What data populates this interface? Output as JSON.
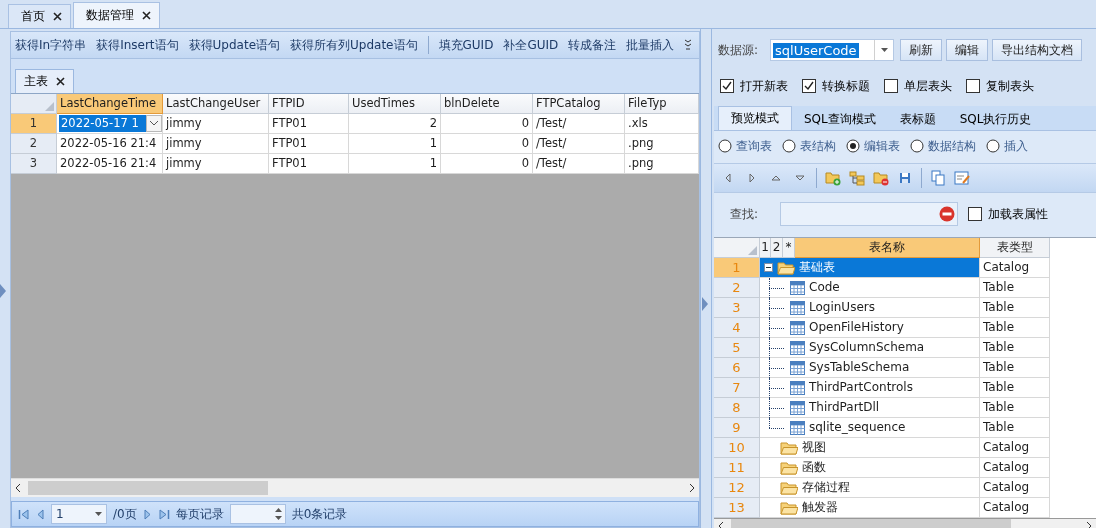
{
  "doc_tabs": [
    {
      "label": "首页",
      "selected": false
    },
    {
      "label": "数据管理",
      "selected": true
    }
  ],
  "toolbar": {
    "groups": [
      [
        "获得In字符串",
        "获得Insert语句",
        "获得Update语句",
        "获得所有列Update语句"
      ],
      [
        "填充GUID",
        "补全GUID",
        "转成备注",
        "批量插入"
      ]
    ]
  },
  "sub_tabs": [
    {
      "label": "主表",
      "selected": true
    }
  ],
  "data_grid": {
    "columns": [
      {
        "label": "LastChangeTime",
        "kind": "text",
        "selected": true
      },
      {
        "label": "LastChangeUser",
        "kind": "text",
        "selected": false
      },
      {
        "label": "FTPID",
        "kind": "text",
        "selected": false
      },
      {
        "label": "UsedTimes",
        "kind": "number",
        "selected": false
      },
      {
        "label": "blnDelete",
        "kind": "number",
        "selected": false
      },
      {
        "label": "FTPCatalog",
        "kind": "text",
        "selected": false
      },
      {
        "label": "FileTyp",
        "kind": "text",
        "selected": false
      }
    ],
    "rows": [
      {
        "number": "1",
        "selected": true,
        "cells": [
          "2022-05-17 1",
          "jimmy",
          "FTP01",
          "2",
          "0",
          "/Test/",
          ".xls"
        ]
      },
      {
        "number": "2",
        "selected": false,
        "cells": [
          "2022-05-16 21:4",
          "jimmy",
          "FTP01",
          "1",
          "0",
          "/Test/",
          ".png"
        ]
      },
      {
        "number": "3",
        "selected": false,
        "cells": [
          "2022-05-16 21:4",
          "jimmy",
          "FTP01",
          "1",
          "0",
          "/Test/",
          ".png"
        ]
      }
    ]
  },
  "pager": {
    "page": "1",
    "pages": "/0页",
    "per_page_label": "每页记录",
    "total": "共0条记录"
  },
  "datasource": {
    "label": "数据源:",
    "value": "sqlUserCode",
    "buttons": [
      "刷新",
      "编辑",
      "导出结构文档"
    ]
  },
  "options": [
    {
      "label": "打开新表",
      "checked": true
    },
    {
      "label": "转换标题",
      "checked": true
    },
    {
      "label": "单层表头",
      "checked": false
    },
    {
      "label": "复制表头",
      "checked": false
    }
  ],
  "mode_tabs": [
    {
      "label": "预览模式",
      "selected": true
    },
    {
      "label": "SQL查询模式",
      "selected": false
    },
    {
      "label": "表标题",
      "selected": false
    },
    {
      "label": "SQL执行历史",
      "selected": false
    }
  ],
  "view_radios": [
    {
      "label": "查询表",
      "selected": false
    },
    {
      "label": "表结构",
      "selected": false
    },
    {
      "label": "编辑表",
      "selected": true
    },
    {
      "label": "数据结构",
      "selected": false
    },
    {
      "label": "插入",
      "selected": false
    }
  ],
  "search": {
    "label": "查找:"
  },
  "load_props": {
    "label": "加载表属性",
    "checked": false
  },
  "tree_grid": {
    "columns": [
      {
        "label": "1",
        "selected": false
      },
      {
        "label": "2",
        "selected": false
      },
      {
        "label": "*",
        "selected": false
      },
      {
        "label": "表名称",
        "selected": true
      },
      {
        "label": "表类型",
        "selected": false
      }
    ],
    "rows": [
      {
        "number": "1",
        "name": "基础表",
        "type": "Catalog",
        "kind": "folder",
        "selected": true,
        "expanded": true,
        "children": [
          {
            "number": "2",
            "name": "Code",
            "type": "Table",
            "kind": "table",
            "selected": false
          },
          {
            "number": "3",
            "name": "LoginUsers",
            "type": "Table",
            "kind": "table",
            "selected": false
          },
          {
            "number": "4",
            "name": "OpenFileHistory",
            "type": "Table",
            "kind": "table",
            "selected": false
          },
          {
            "number": "5",
            "name": "SysColumnSchema",
            "type": "Table",
            "kind": "table",
            "selected": false
          },
          {
            "number": "6",
            "name": "SysTableSchema",
            "type": "Table",
            "kind": "table",
            "selected": false
          },
          {
            "number": "7",
            "name": "ThirdPartControls",
            "type": "Table",
            "kind": "table",
            "selected": false
          },
          {
            "number": "8",
            "name": "ThirdPartDll",
            "type": "Table",
            "kind": "table",
            "selected": false
          },
          {
            "number": "9",
            "name": "sqlite_sequence",
            "type": "Table",
            "kind": "table",
            "selected": false
          }
        ]
      },
      {
        "number": "10",
        "name": "视图",
        "type": "Catalog",
        "kind": "folder",
        "selected": false
      },
      {
        "number": "11",
        "name": "函数",
        "type": "Catalog",
        "kind": "folder",
        "selected": false
      },
      {
        "number": "12",
        "name": "存储过程",
        "type": "Catalog",
        "kind": "folder",
        "selected": false
      },
      {
        "number": "13",
        "name": "触发器",
        "type": "Catalog",
        "kind": "folder",
        "selected": false
      }
    ]
  }
}
